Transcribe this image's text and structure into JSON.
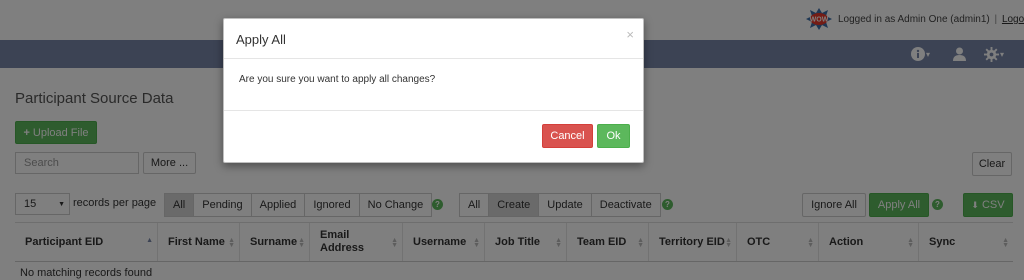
{
  "header": {
    "logo_text": "WOW",
    "login_text": "Logged in as Admin One (admin1)",
    "separator": "|",
    "logout": "Logout"
  },
  "nav": {
    "icons": [
      "info-icon",
      "user-icon",
      "gear-icon"
    ],
    "caret": "▾"
  },
  "page": {
    "title": "Participant Source Data",
    "upload_button": "Upload File",
    "search_placeholder": "Search",
    "more_button": "More ...",
    "clear_button": "Clear",
    "records_per_page_value": "15",
    "records_per_page_label": "records per page",
    "status_filters": [
      "All",
      "Pending",
      "Applied",
      "Ignored",
      "No Change"
    ],
    "status_active": "All",
    "action_filters": [
      "All",
      "Create",
      "Update",
      "Deactivate"
    ],
    "action_active": "Create",
    "ignore_all_button": "Ignore All",
    "apply_all_button": "Apply All",
    "csv_button": "CSV",
    "help_glyph": "?",
    "table": {
      "columns": [
        "Participant EID",
        "First Name",
        "Surname",
        "Email Address",
        "Username",
        "Job Title",
        "Team EID",
        "Territory EID",
        "OTC",
        "Action",
        "Sync"
      ],
      "empty_message": "No matching records found"
    }
  },
  "modal": {
    "title": "Apply All",
    "close": "×",
    "message": "Are you sure you want to apply all changes?",
    "cancel": "Cancel",
    "ok": "Ok"
  },
  "colors": {
    "navbar": "#7886a9",
    "success": "#5cb85c",
    "danger": "#d9534f"
  }
}
